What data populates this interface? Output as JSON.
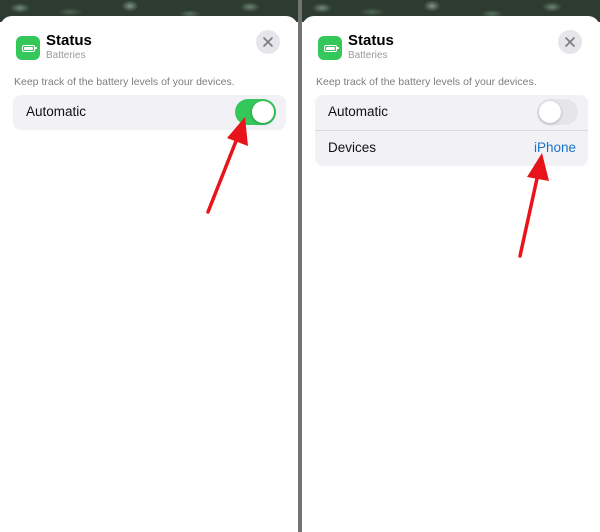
{
  "left_panel": {
    "title": "Status",
    "subtitle": "Batteries",
    "description": "Keep track of the battery levels of your devices.",
    "automatic_label": "Automatic",
    "automatic_toggle_state": "on"
  },
  "right_panel": {
    "title": "Status",
    "subtitle": "Batteries",
    "description": "Keep track of the battery levels of your devices.",
    "automatic_label": "Automatic",
    "automatic_toggle_state": "off",
    "devices_label": "Devices",
    "devices_value": "iPhone"
  },
  "icons": {
    "app": "battery-icon",
    "close": "close-icon",
    "annotation": "red-arrow"
  },
  "colors": {
    "accent_green": "#34c759",
    "link_blue": "#1a73c9",
    "annotation_red": "#e8141b"
  }
}
